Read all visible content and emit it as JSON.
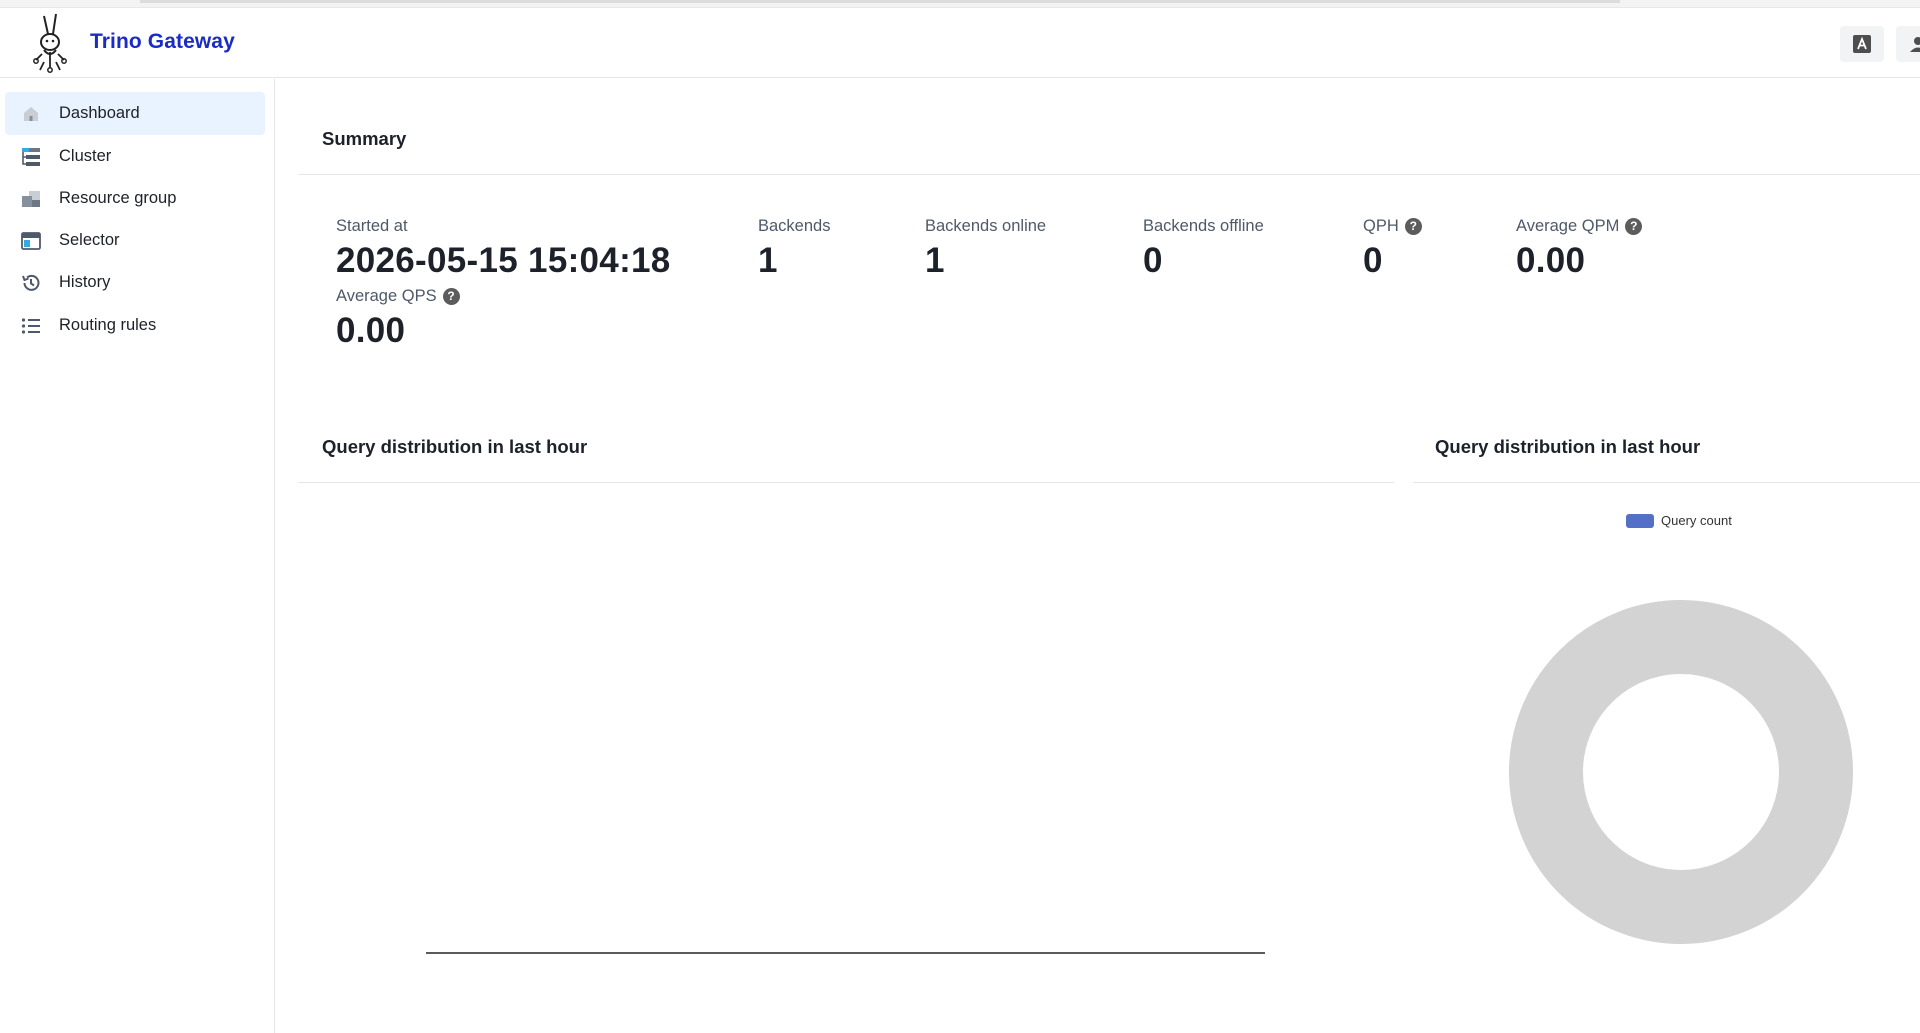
{
  "app": {
    "brand": "Trino Gateway"
  },
  "header": {
    "translate_icon": "translate-icon",
    "user_icon": "user-icon"
  },
  "sidebar": {
    "items": [
      {
        "label": "Dashboard",
        "icon": "home-icon",
        "active": true
      },
      {
        "label": "Cluster",
        "icon": "cluster-icon"
      },
      {
        "label": "Resource group",
        "icon": "resource-group-icon"
      },
      {
        "label": "Selector",
        "icon": "selector-icon"
      },
      {
        "label": "History",
        "icon": "history-icon"
      },
      {
        "label": "Routing rules",
        "icon": "list-icon"
      }
    ]
  },
  "summary": {
    "title": "Summary",
    "started_at": {
      "label": "Started at",
      "value": "2026-05-15 15:04:18"
    },
    "backends": {
      "label": "Backends",
      "value": "1"
    },
    "backends_online": {
      "label": "Backends online",
      "value": "1"
    },
    "backends_offline": {
      "label": "Backends offline",
      "value": "0"
    },
    "qph": {
      "label": "QPH",
      "value": "0"
    },
    "average_qpm": {
      "label": "Average QPM",
      "value": "0.00"
    },
    "average_qps": {
      "label": "Average QPS",
      "value": "0.00"
    }
  },
  "charts": {
    "left_title": "Query distribution in last hour",
    "right_title": "Query distribution in last hour",
    "legend_label": "Query count"
  },
  "colors": {
    "accent": "#1a2cc4",
    "legend_swatch": "#5470c6",
    "donut_empty": "#d3d3d3",
    "active_bg": "#e8f3ff"
  },
  "chart_data": [
    {
      "type": "line",
      "title": "Query distribution in last hour",
      "series": []
    },
    {
      "type": "pie",
      "title": "Query distribution in last hour",
      "legend": [
        "Query count"
      ],
      "values": []
    }
  ]
}
